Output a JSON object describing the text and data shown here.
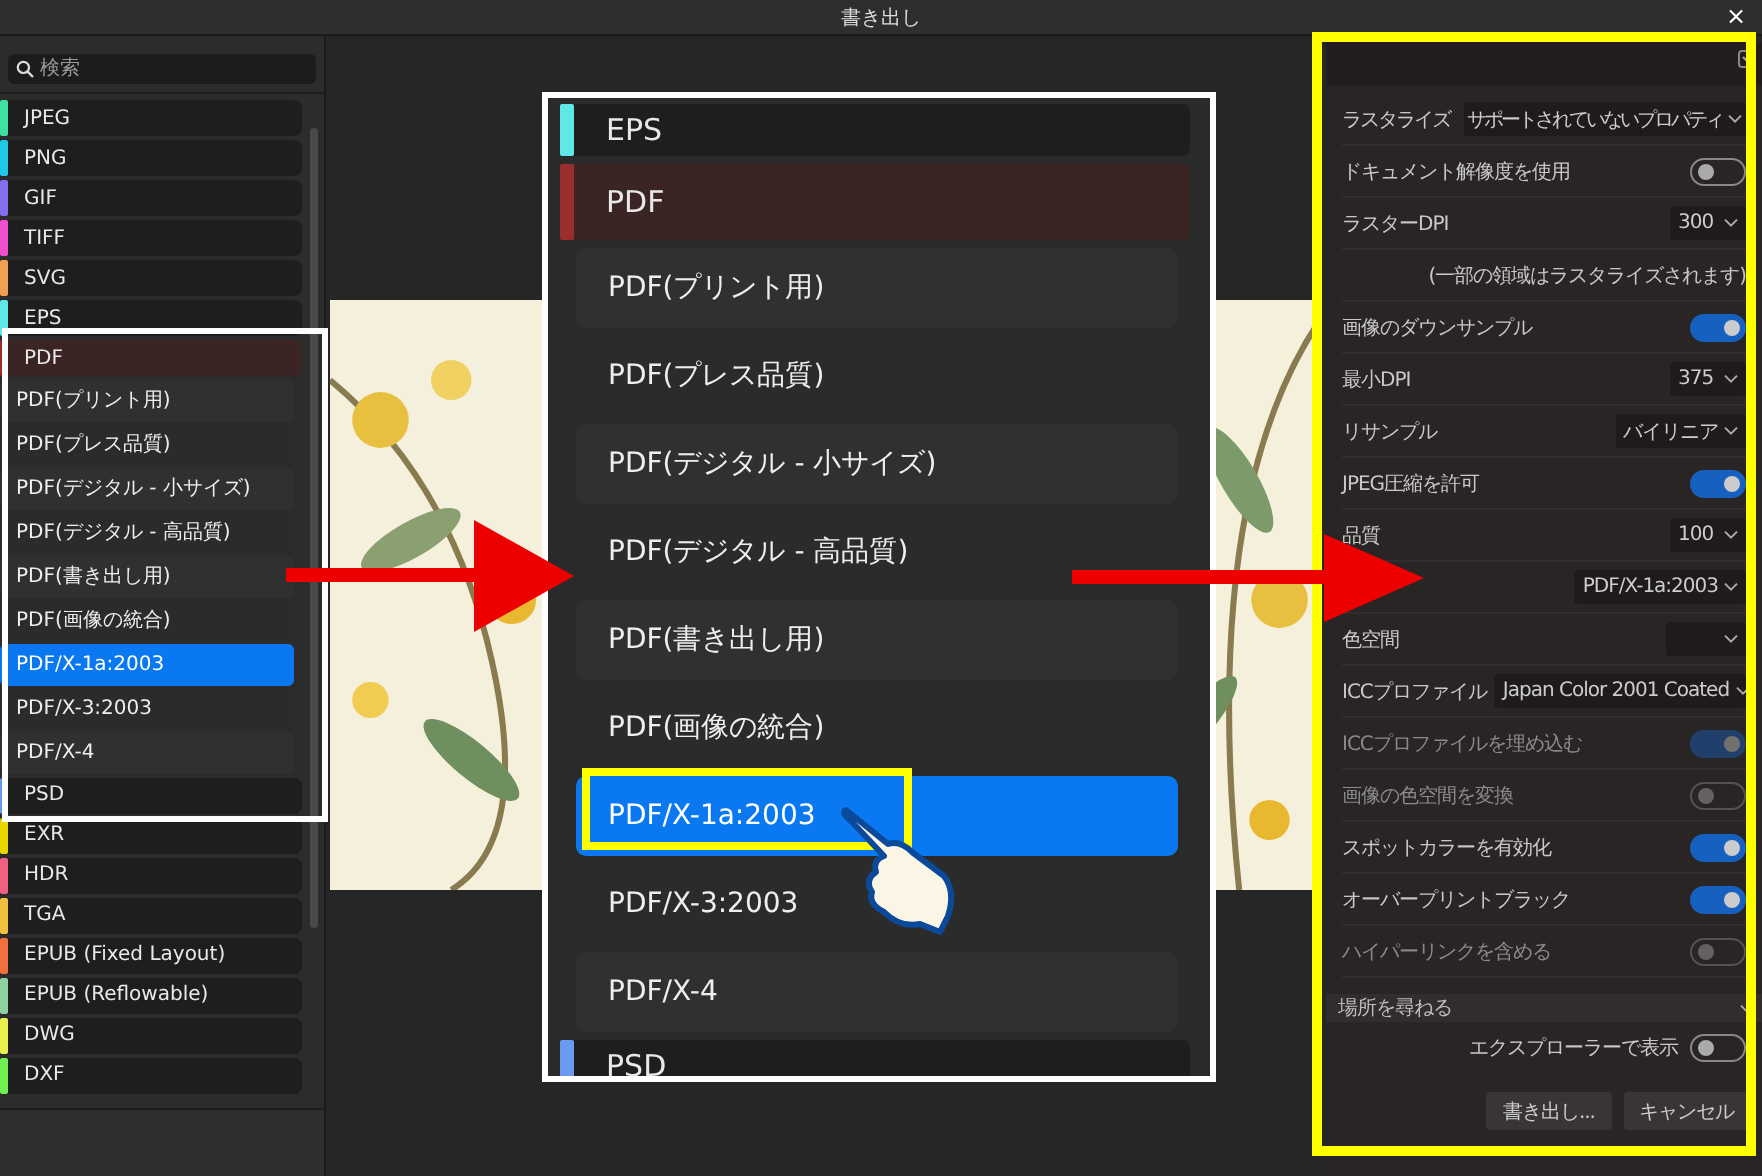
{
  "window": {
    "title": "書き出し",
    "close": "×"
  },
  "search": {
    "placeholder": "検索"
  },
  "formats": [
    {
      "label": "JPEG",
      "color": "#40e0a0",
      "expanded": false
    },
    {
      "label": "PNG",
      "color": "#20c8e8",
      "expanded": false
    },
    {
      "label": "GIF",
      "color": "#8070f0",
      "expanded": false
    },
    {
      "label": "TIFF",
      "color": "#f050d0",
      "expanded": false
    },
    {
      "label": "SVG",
      "color": "#f0a050",
      "expanded": false
    },
    {
      "label": "EPS",
      "color": "#60e8e8",
      "expanded": false
    },
    {
      "label": "PDF",
      "color": "#9a2e2e",
      "expanded": true,
      "children": [
        {
          "label": "PDF(プリント用)",
          "selected": false
        },
        {
          "label": "PDF(プレス品質)",
          "selected": false
        },
        {
          "label": "PDF(デジタル - 小サイズ)",
          "selected": false
        },
        {
          "label": "PDF(デジタル - 高品質)",
          "selected": false
        },
        {
          "label": "PDF(書き出し用)",
          "selected": false
        },
        {
          "label": "PDF(画像の統合)",
          "selected": false
        },
        {
          "label": "PDF/X-1a:2003",
          "selected": true
        },
        {
          "label": "PDF/X-3:2003",
          "selected": false
        },
        {
          "label": "PDF/X-4",
          "selected": false
        }
      ]
    },
    {
      "label": "PSD",
      "color": "#6a9af0",
      "expanded": false
    },
    {
      "label": "EXR",
      "color": "#e8d800",
      "expanded": false
    },
    {
      "label": "HDR",
      "color": "#f06080",
      "expanded": false
    },
    {
      "label": "TGA",
      "color": "#f0c040",
      "expanded": false
    },
    {
      "label": "EPUB (Fixed Layout)",
      "color": "#f07040",
      "expanded": false
    },
    {
      "label": "EPUB (Reflowable)",
      "color": "#90d0a0",
      "expanded": false
    },
    {
      "label": "DWG",
      "color": "#e8f050",
      "expanded": false
    },
    {
      "label": "DXF",
      "color": "#70f050",
      "expanded": false
    }
  ],
  "zoom_callout": {
    "formats": [
      {
        "label": "EPS",
        "color": "#60e8e8",
        "expanded": false
      },
      {
        "label": "PDF",
        "color": "#9a2e2e",
        "expanded": true,
        "children": [
          {
            "label": "PDF(プリント用)",
            "selected": false
          },
          {
            "label": "PDF(プレス品質)",
            "selected": false
          },
          {
            "label": "PDF(デジタル - 小サイズ)",
            "selected": false
          },
          {
            "label": "PDF(デジタル - 高品質)",
            "selected": false
          },
          {
            "label": "PDF(書き出し用)",
            "selected": false
          },
          {
            "label": "PDF(画像の統合)",
            "selected": false
          },
          {
            "label": "PDF/X-1a:2003",
            "selected": true
          },
          {
            "label": "PDF/X-3:2003",
            "selected": false
          },
          {
            "label": "PDF/X-4",
            "selected": false
          }
        ]
      },
      {
        "label": "PSD",
        "color": "#6a9af0",
        "expanded": false
      }
    ]
  },
  "settings": {
    "rows": [
      {
        "kind": "select",
        "label": "ラスタライズ",
        "value": "サポートされていないプロパティ",
        "disabled": false
      },
      {
        "kind": "toggle",
        "label": "ドキュメント解像度を使用",
        "on": false,
        "disabled": false
      },
      {
        "kind": "select",
        "label": "ラスターDPI",
        "value": "300",
        "disabled": false
      },
      {
        "kind": "note",
        "label": "(一部の領域はラスタライズされます)"
      },
      {
        "kind": "toggle",
        "label": "画像のダウンサンプル",
        "on": true,
        "disabled": false
      },
      {
        "kind": "select",
        "label": "最小DPI",
        "value": "375",
        "disabled": false
      },
      {
        "kind": "select",
        "label": "リサンプル",
        "value": "バイリニア",
        "disabled": false
      },
      {
        "kind": "toggle",
        "label": "JPEG圧縮を許可",
        "on": true,
        "disabled": false
      },
      {
        "kind": "select",
        "label": "品質",
        "value": "100",
        "disabled": false
      },
      {
        "kind": "select",
        "value": "PDF/X-1a:2003"
      },
      {
        "kind": "select",
        "label": "色空間",
        "disabled": false
      },
      {
        "kind": "select",
        "label": "ICCプロファイル",
        "value": "Japan Color 2001 Coated",
        "disabled": false
      },
      {
        "kind": "toggle",
        "label": "ICCプロファイルを埋め込む",
        "on": true,
        "disabled": true
      },
      {
        "kind": "toggle",
        "label": "画像の色空間を変換",
        "on": false,
        "disabled": true
      },
      {
        "kind": "toggle",
        "label": "スポットカラーを有効化",
        "on": true,
        "disabled": false
      },
      {
        "kind": "toggle",
        "label": "オーバープリントブラック",
        "on": true,
        "disabled": false
      },
      {
        "kind": "toggle",
        "label": "ハイパーリンクを含める",
        "on": false,
        "disabled": true
      }
    ]
  },
  "location": {
    "value": "場所を尋ねる"
  },
  "show_in_explorer": {
    "label": "エクスプローラーで表示",
    "on": false
  },
  "buttons": [
    {
      "label": "書き出し..."
    },
    {
      "label": "キャンセル"
    }
  ]
}
